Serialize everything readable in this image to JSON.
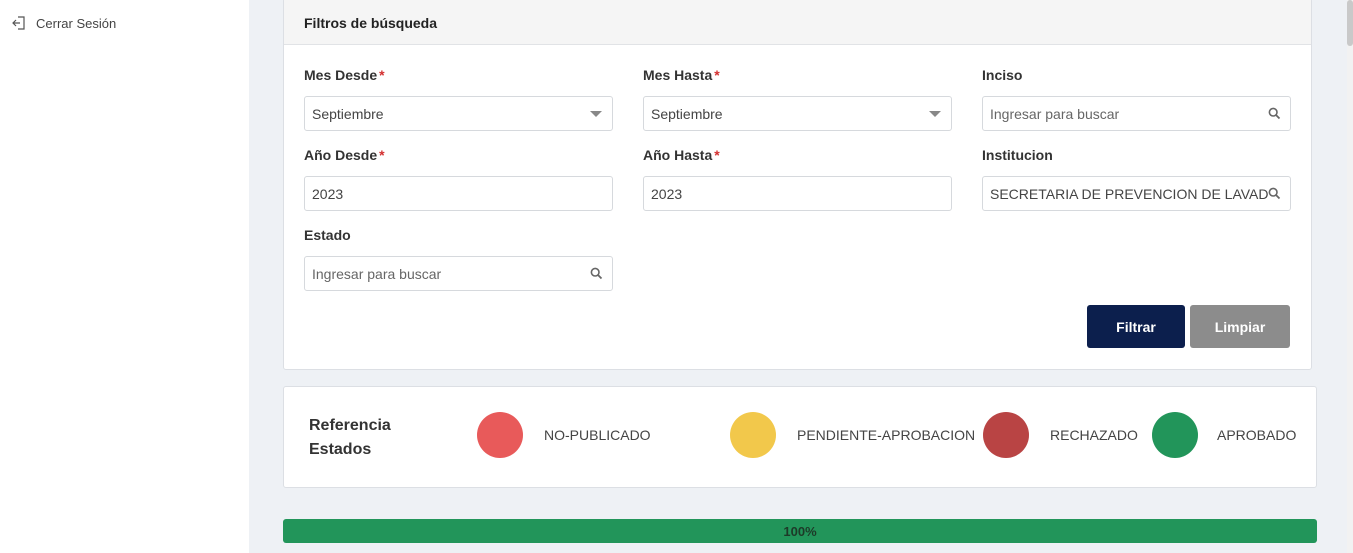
{
  "sidebar": {
    "logout_label": "Cerrar Sesión",
    "logout_icon": "logout-icon"
  },
  "filters": {
    "title": "Filtros de búsqueda",
    "mes_desde": {
      "label": "Mes Desde",
      "required": "*",
      "value": "Septiembre"
    },
    "mes_hasta": {
      "label": "Mes Hasta",
      "required": "*",
      "value": "Septiembre"
    },
    "inciso": {
      "label": "Inciso",
      "placeholder": "Ingresar para buscar"
    },
    "anio_desde": {
      "label": "Año Desde",
      "required": "*",
      "value": "2023"
    },
    "anio_hasta": {
      "label": "Año Hasta",
      "required": "*",
      "value": "2023"
    },
    "institucion": {
      "label": "Institucion",
      "value": "SECRETARIA DE PREVENCION DE LAVADO DE"
    },
    "estado": {
      "label": "Estado",
      "placeholder": "Ingresar para buscar"
    },
    "filter_button": "Filtrar",
    "clear_button": "Limpiar"
  },
  "reference": {
    "title": "Referencia Estados",
    "items": [
      {
        "label": "NO-PUBLICADO",
        "color": "#e85a5a"
      },
      {
        "label": "PENDIENTE-APROBACION",
        "color": "#f2c84b"
      },
      {
        "label": "RECHAZADO",
        "color": "#b94444"
      },
      {
        "label": "APROBADO",
        "color": "#22955a"
      }
    ]
  },
  "progress": {
    "value": 100,
    "label": "100%"
  },
  "colors": {
    "primary_button": "#0c1f4d",
    "secondary_button": "#8c8c8c",
    "progress": "#22955a",
    "required": "#d32f2f"
  }
}
